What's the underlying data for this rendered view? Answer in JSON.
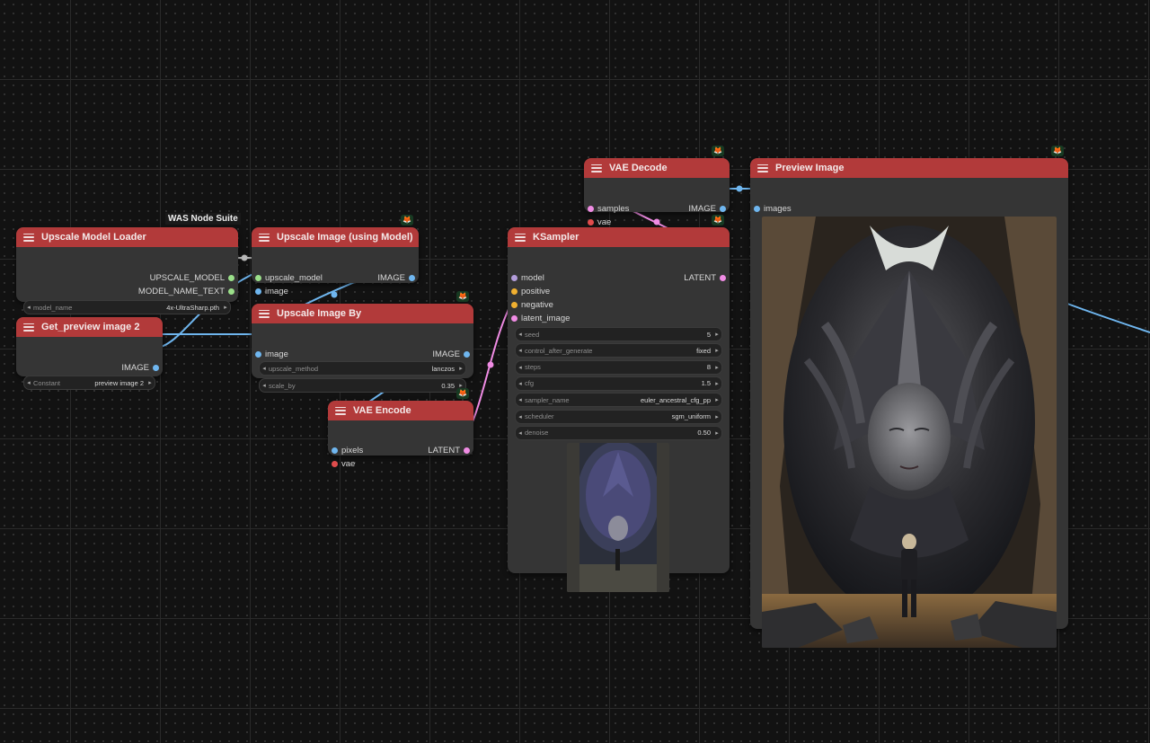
{
  "suite_label": "WAS Node Suite",
  "colors": {
    "node_header": "#b23a3a",
    "node_body": "#353535",
    "image_link": "#6fb6ef",
    "latent_link": "#f08ce4",
    "vae_socket": "#e04c4c",
    "model_socket": "#b39ddb",
    "conditioning_socket": "#f0b030",
    "upscale_model_socket": "#9be08a"
  },
  "nodes": {
    "upscale_model_loader": {
      "title": "Upscale Model Loader",
      "outputs": [
        "UPSCALE_MODEL",
        "MODEL_NAME_TEXT"
      ],
      "widget": {
        "name": "model_name",
        "value": "4x-UltraSharp.pth"
      }
    },
    "get_preview": {
      "title": "Get_preview image 2",
      "outputs": [
        "IMAGE"
      ],
      "widget": {
        "name": "Constant",
        "value": "preview image 2"
      }
    },
    "upscale_using_model": {
      "title": "Upscale Image (using Model)",
      "inputs": [
        "upscale_model",
        "image"
      ],
      "outputs": [
        "IMAGE"
      ]
    },
    "upscale_by": {
      "title": "Upscale Image By",
      "inputs": [
        "image"
      ],
      "outputs": [
        "IMAGE"
      ],
      "widgets": [
        {
          "name": "upscale_method",
          "value": "lanczos"
        },
        {
          "name": "scale_by",
          "value": "0.35"
        }
      ]
    },
    "vae_encode": {
      "title": "VAE Encode",
      "inputs": [
        "pixels",
        "vae"
      ],
      "outputs": [
        "LATENT"
      ]
    },
    "ksampler": {
      "title": "KSampler",
      "inputs": [
        "model",
        "positive",
        "negative",
        "latent_image"
      ],
      "outputs": [
        "LATENT"
      ],
      "widgets": [
        {
          "name": "seed",
          "value": "5"
        },
        {
          "name": "control_after_generate",
          "value": "fixed"
        },
        {
          "name": "steps",
          "value": "8"
        },
        {
          "name": "cfg",
          "value": "1.5"
        },
        {
          "name": "sampler_name",
          "value": "euler_ancestral_cfg_pp"
        },
        {
          "name": "scheduler",
          "value": "sgm_uniform"
        },
        {
          "name": "denoise",
          "value": "0.50"
        }
      ]
    },
    "vae_decode": {
      "title": "VAE Decode",
      "inputs": [
        "samples",
        "vae"
      ],
      "outputs": [
        "IMAGE"
      ]
    },
    "preview_image": {
      "title": "Preview Image",
      "inputs": [
        "images"
      ]
    }
  },
  "icons": {
    "node_badge": "fox-icon",
    "node_menu": "hamburger-icon",
    "widget_left": "◂",
    "widget_right": "▸",
    "fox_glyph": "🦊"
  }
}
